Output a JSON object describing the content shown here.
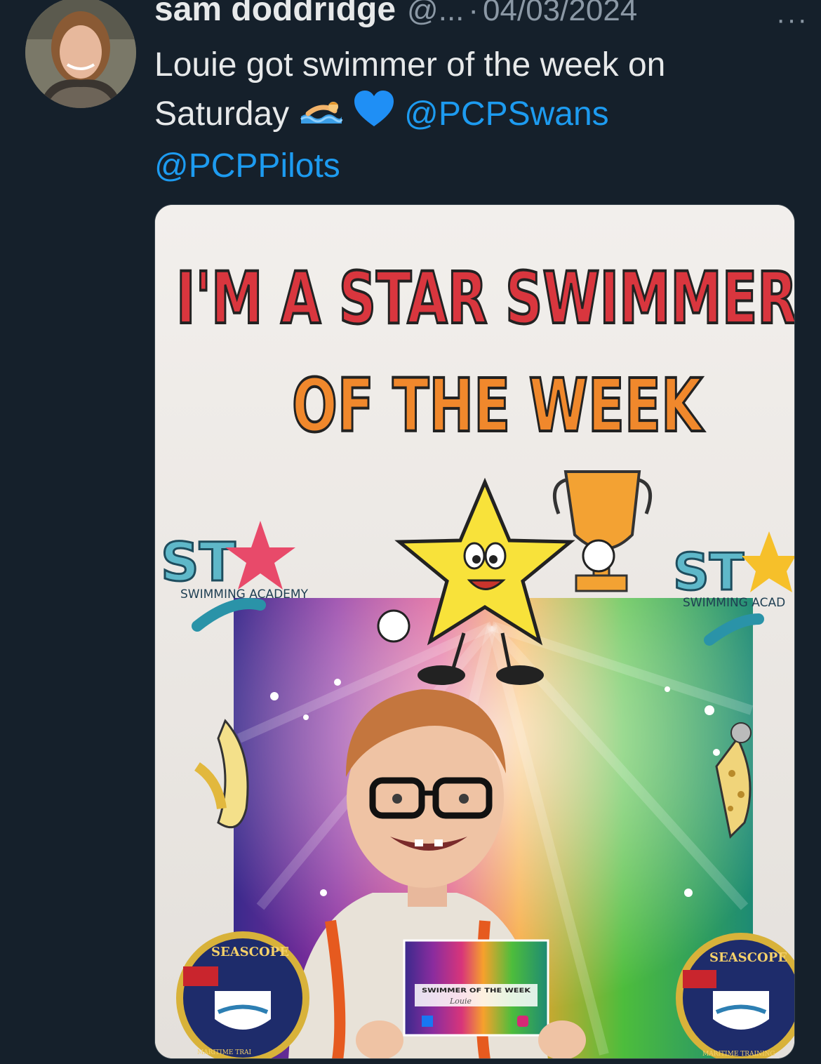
{
  "tweet": {
    "author_name": "sam doddridge",
    "handle": "@...",
    "separator": "·",
    "date": "04/03/2024",
    "more_label": "···",
    "text_part1": "Louie got swimmer of the week on Saturday",
    "mention1": "@PCPSwans",
    "mention2": "@PCPPilots",
    "emojis": [
      "swimmer-emoji",
      "blue-heart-emoji"
    ]
  },
  "media": {
    "banner_line1": "I'M A STAR SWIMMER",
    "banner_line2": "OF THE WEEK",
    "logo_left_text": "SWIMMING ACADEMY",
    "logo_right_text": "SWIMMING ACAD",
    "logo_star_prefix": "ST",
    "badge_text_left": "SEASCOPE",
    "badge_text_right": "SEASCOPE",
    "badge_bottom_left": "MARITIME TRAI",
    "badge_bottom_right": "MARITIME TRAINING",
    "certificate_title": "SWIMMER OF THE WEEK",
    "certificate_name": "Louie"
  },
  "colors": {
    "background": "#15202b",
    "text": "#e7e9ea",
    "muted": "#8b98a5",
    "link": "#1d9bf0"
  }
}
